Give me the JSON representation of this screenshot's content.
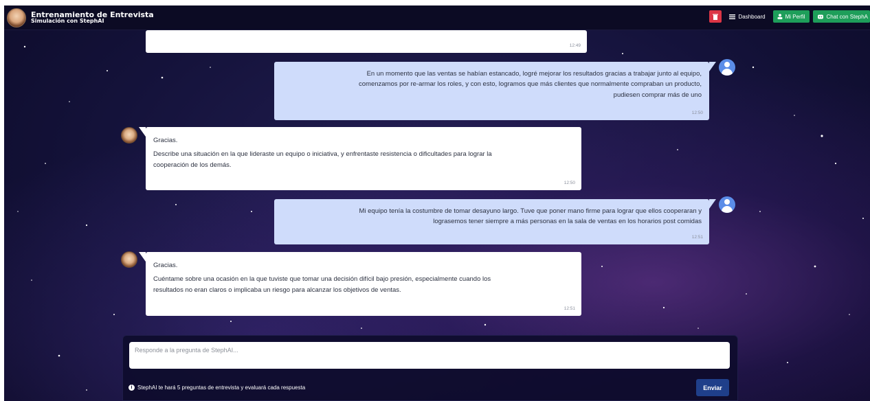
{
  "header": {
    "title": "Entrenamiento de Entrevista",
    "subtitle": "Simulación con StephAI",
    "nav": {
      "dashboard": "Dashboard",
      "profile": "Mi Perfil",
      "chat": "Chat con StephA"
    }
  },
  "messages": [
    {
      "role": "bot",
      "lines": [],
      "time": "12:49"
    },
    {
      "role": "user",
      "lines": [
        "En un momento que las ventas se habían estancado, logré mejorar los resultados gracias a trabajar junto al equipo,",
        "comenzamos por re-armar los roles, y con esto, logramos que más clientes que normalmente compraban un producto,",
        "pudiesen comprar más de uno"
      ],
      "time": "12:50"
    },
    {
      "role": "bot",
      "lines": [
        "Gracias.",
        "Describe una situación en la que lideraste un equipo o iniciativa, y enfrentaste resistencia o dificultades para lograr la",
        "cooperación de los demás."
      ],
      "time": "12:50"
    },
    {
      "role": "user",
      "lines": [
        "Mi equipo tenía la costumbre de tomar desayuno largo. Tuve que poner mano firme para lograr que ellos cooperaran y",
        "lograsemos tener siempre a más personas en la sala de ventas en los horarios post comidas"
      ],
      "time": "12:51"
    },
    {
      "role": "bot",
      "lines": [
        "Gracias.",
        "Cuéntame sobre una ocasión en la que tuviste que tomar una decisión difícil bajo presión, especialmente cuando los",
        "resultados no eran claros o implicaba un riesgo para alcanzar los objetivos de ventas."
      ],
      "time": "12:51"
    }
  ],
  "composer": {
    "placeholder": "Responde a la pregunta de StephAI...",
    "hint": "StephAI te hará 5 preguntas de entrevista y evaluará cada respuesta",
    "send_label": "Enviar"
  },
  "colors": {
    "user_bubble": "#cfdcfb",
    "bot_bubble": "#ffffff",
    "danger": "#dc3545",
    "success": "#1e9e5a",
    "send": "#1f3f8a"
  }
}
